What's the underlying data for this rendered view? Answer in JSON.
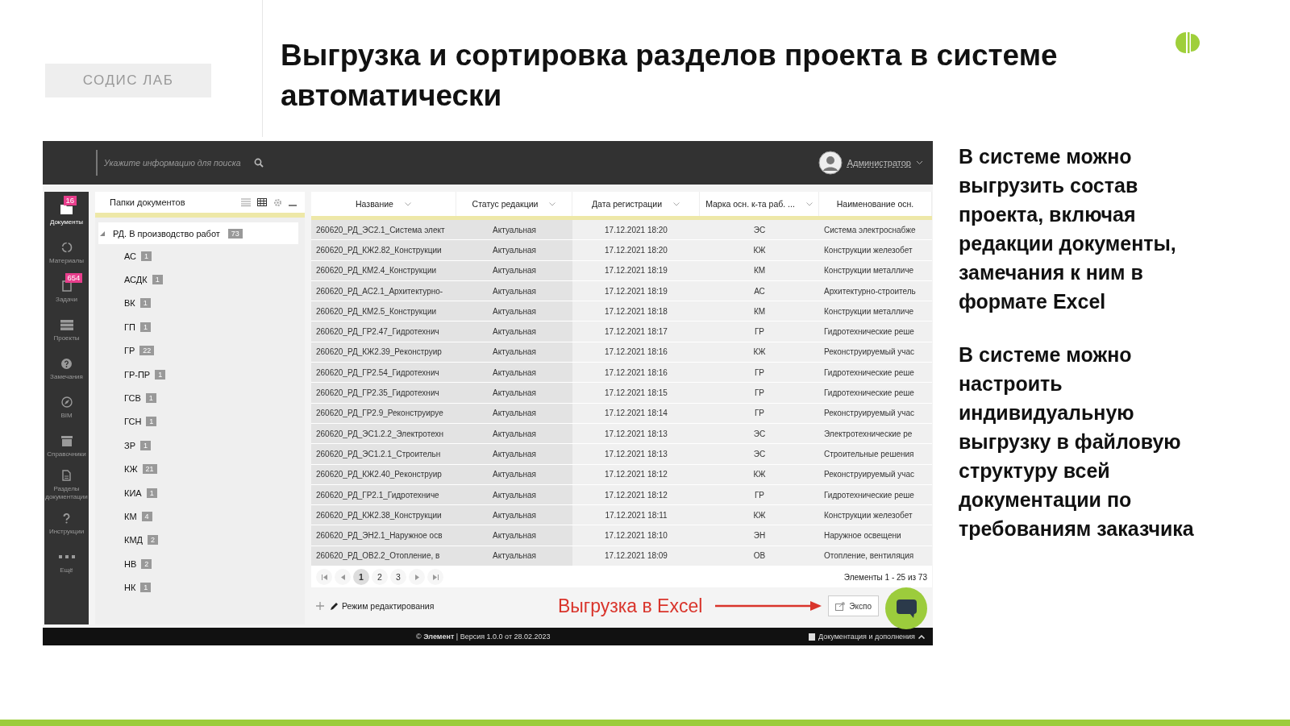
{
  "brand": {
    "label": "СОДИС ЛАБ"
  },
  "slide_title": "Выгрузка и сортировка разделов проекта в системе автоматически",
  "app": {
    "search": {
      "placeholder": "Укажите информацию для поиска"
    },
    "user": {
      "name": "Администратор"
    },
    "sidebar": {
      "items": [
        {
          "kind": "folder",
          "label": "Документы",
          "badge": "16",
          "selected": true
        },
        {
          "kind": "circle",
          "label": "Материалы",
          "selected": false
        },
        {
          "kind": "doc",
          "label": "Задачи",
          "badge": "654",
          "selected": false
        },
        {
          "kind": "stack",
          "label": "Проекты",
          "selected": false
        },
        {
          "kind": "question",
          "label": "Замечания",
          "selected": false
        },
        {
          "kind": "compass",
          "label": "BIM",
          "selected": false
        },
        {
          "kind": "box",
          "label": "Справочники",
          "selected": false
        },
        {
          "kind": "file",
          "label": "Разделы документации",
          "selected": false
        },
        {
          "kind": "help",
          "label": "Инструкции",
          "selected": false
        },
        {
          "kind": "dots",
          "label": "Ещё",
          "selected": false
        }
      ]
    },
    "folders": {
      "title": "Папки документов",
      "tree": [
        {
          "label": "РД. В производство работ",
          "count": "73",
          "expanded": true,
          "selected": true,
          "children": [
            {
              "label": "АС",
              "count": "1",
              "selected": false
            },
            {
              "label": "АСДК",
              "count": "1",
              "selected": false
            },
            {
              "label": "ВК",
              "count": "1",
              "selected": false
            },
            {
              "label": "ГП",
              "count": "1",
              "selected": false
            },
            {
              "label": "ГР",
              "count": "22",
              "selected": false
            },
            {
              "label": "ГР-ПР",
              "count": "1",
              "selected": false
            },
            {
              "label": "ГСВ",
              "count": "1",
              "selected": false
            },
            {
              "label": "ГСН",
              "count": "1",
              "selected": false
            },
            {
              "label": "ЗР",
              "count": "1",
              "selected": false
            },
            {
              "label": "КЖ",
              "count": "21",
              "selected": false
            },
            {
              "label": "КИА",
              "count": "1",
              "selected": false
            },
            {
              "label": "КМ",
              "count": "4",
              "selected": false
            },
            {
              "label": "КМД",
              "count": "2",
              "selected": false
            },
            {
              "label": "НВ",
              "count": "2",
              "selected": false
            },
            {
              "label": "НК",
              "count": "1",
              "selected": false
            }
          ]
        }
      ]
    },
    "table": {
      "columns": [
        "Название",
        "Статус редакции",
        "Дата регистрации",
        "Марка осн. к-та раб. ...",
        "Наименование осн."
      ],
      "rows": [
        [
          "260620_РД_ЭС2.1_Система элект",
          "Актуальная",
          "17.12.2021 18:20",
          "ЭС",
          "Система электроснабже"
        ],
        [
          "260620_РД_КЖ2.82_Конструкции",
          "Актуальная",
          "17.12.2021 18:20",
          "КЖ",
          "Конструкции железобет"
        ],
        [
          "260620_РД_КМ2.4_Конструкции",
          "Актуальная",
          "17.12.2021 18:19",
          "КМ",
          "Конструкции металличе"
        ],
        [
          "260620_РД_АС2.1_Архитектурно-",
          "Актуальная",
          "17.12.2021 18:19",
          "АС",
          "Архитектурно-строитель"
        ],
        [
          "260620_РД_КМ2.5_Конструкции",
          "Актуальная",
          "17.12.2021 18:18",
          "КМ",
          "Конструкции металличе"
        ],
        [
          "260620_РД_ГР2.47_Гидротехнич",
          "Актуальная",
          "17.12.2021 18:17",
          "ГР",
          "Гидротехнические реше"
        ],
        [
          "260620_РД_КЖ2.39_Реконструир",
          "Актуальная",
          "17.12.2021 18:16",
          "КЖ",
          "Реконструируемый учас"
        ],
        [
          "260620_РД_ГР2.54_Гидротехнич",
          "Актуальная",
          "17.12.2021 18:16",
          "ГР",
          "Гидротехнические реше"
        ],
        [
          "260620_РД_ГР2.35_Гидротехнич",
          "Актуальная",
          "17.12.2021 18:15",
          "ГР",
          "Гидротехнические реше"
        ],
        [
          "260620_РД_ГР2.9_Реконструируе",
          "Актуальная",
          "17.12.2021 18:14",
          "ГР",
          "Реконструируемый учас"
        ],
        [
          "260620_РД_ЭС1.2.2_Электротехн",
          "Актуальная",
          "17.12.2021 18:13",
          "ЭС",
          "Электротехнические ре"
        ],
        [
          "260620_РД_ЭС1.2.1_Строительн",
          "Актуальная",
          "17.12.2021 18:13",
          "ЭС",
          "Строительные решения"
        ],
        [
          "260620_РД_КЖ2.40_Реконструир",
          "Актуальная",
          "17.12.2021 18:12",
          "КЖ",
          "Реконструируемый учас"
        ],
        [
          "260620_РД_ГР2.1_Гидротехниче",
          "Актуальная",
          "17.12.2021 18:12",
          "ГР",
          "Гидротехнические реше"
        ],
        [
          "260620_РД_КЖ2.38_Конструкции",
          "Актуальная",
          "17.12.2021 18:11",
          "КЖ",
          "Конструкции железобет"
        ],
        [
          "260620_РД_ЭН2.1_Наружное осв",
          "Актуальная",
          "17.12.2021 18:10",
          "ЭН",
          "Наружное освещени"
        ],
        [
          "260620_РД_ОВ2.2_Отопление, в",
          "Актуальная",
          "17.12.2021 18:09",
          "ОВ",
          "Отопление, вентиляция"
        ]
      ]
    },
    "pagination": {
      "pages": [
        {
          "label": "1",
          "selected": true
        },
        {
          "label": "2",
          "selected": false
        },
        {
          "label": "3",
          "selected": false
        }
      ],
      "summary": "Элементы 1 - 25 из 73"
    },
    "edit_mode": "Режим редактирования",
    "callout": "Выгрузка в Excel",
    "export_button": "Экспо",
    "footer": {
      "left": "© **Элемент**  |  Версия 1.0.0 от 28.02.2023",
      "right": "Документация и дополнения"
    }
  },
  "notes": [
    "В системе можно выгрузить состав проекта, включая редакции документы, замечания к ним в формате Excel",
    "В системе можно настроить индивидуальную выгрузку в файловую структуру всей документации по требованиям заказчика"
  ]
}
